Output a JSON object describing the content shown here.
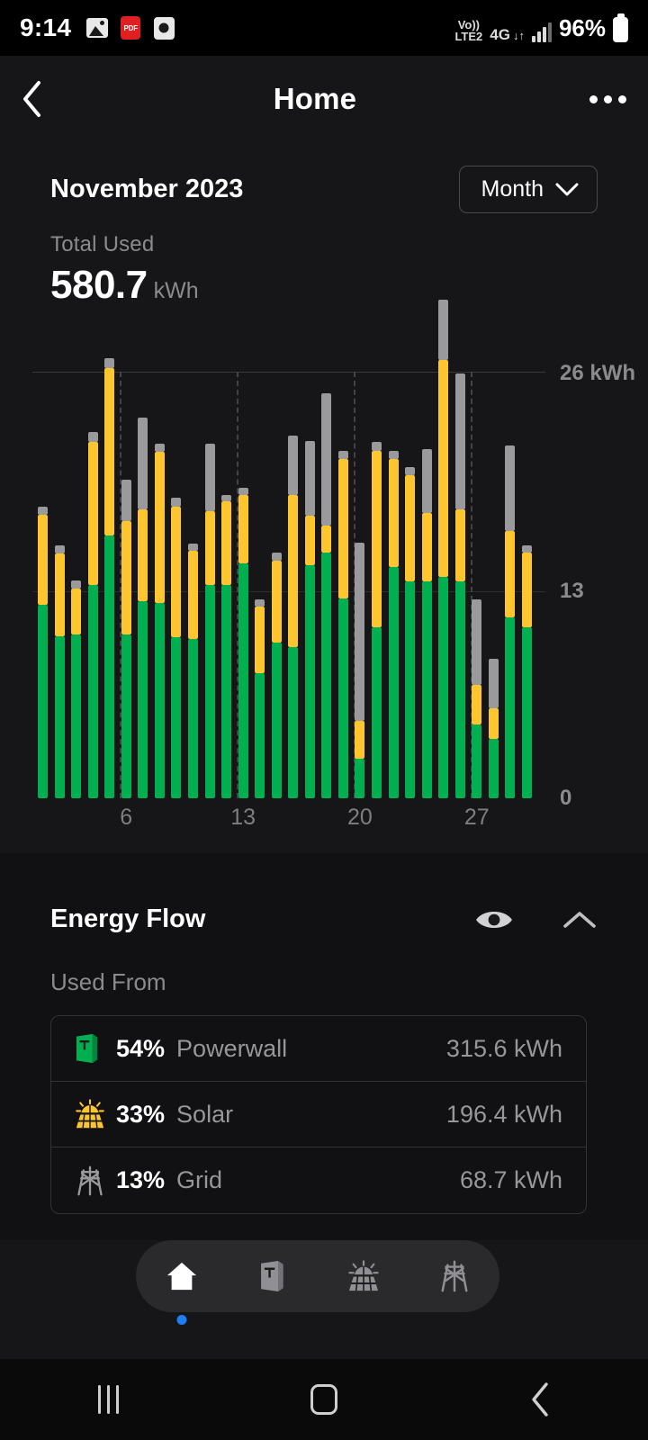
{
  "statusbar": {
    "time": "9:14",
    "icons": [
      "photo-icon",
      "pdf-icon",
      "clock-icon"
    ],
    "volte_top": "Vo))",
    "volte_bottom": "LTE2",
    "network": "4G",
    "data_arrows": "↓↑",
    "battery_pct": "96%"
  },
  "header": {
    "back_icon": "chevron-left-icon",
    "title": "Home",
    "overflow_icon": "more-options-icon"
  },
  "date_row": {
    "month_year": "November 2023",
    "period_label": "Month",
    "period_chevron": "chevron-down-icon"
  },
  "total": {
    "label": "Total Used",
    "value": "580.7",
    "unit": "kWh"
  },
  "chart_data": {
    "type": "bar",
    "title": "",
    "subtitle": "",
    "xlabel": "",
    "ylabel": "kWh",
    "ylim": [
      0,
      26
    ],
    "yticks": [
      0,
      13,
      26
    ],
    "ytick_labels": [
      "0",
      "13",
      "26 kWh"
    ],
    "grid": true,
    "legend_position": "none",
    "stacked": true,
    "categories": [
      1,
      2,
      3,
      4,
      5,
      6,
      7,
      8,
      9,
      10,
      11,
      12,
      13,
      14,
      15,
      16,
      17,
      18,
      19,
      20,
      21,
      22,
      23,
      24,
      25,
      26,
      27,
      28,
      29,
      30
    ],
    "xtick_labels": [
      "6",
      "13",
      "20",
      "27"
    ],
    "xtick_positions": [
      6,
      13,
      20,
      27
    ],
    "series": [
      {
        "name": "Powerwall",
        "color": "#00b050",
        "values": [
          11.8,
          9.9,
          10.0,
          13.0,
          16.0,
          10.0,
          12.0,
          11.9,
          9.8,
          9.7,
          13.0,
          13.0,
          14.3,
          7.6,
          9.5,
          9.2,
          14.2,
          15.0,
          12.2,
          2.4,
          10.4,
          14.1,
          13.2,
          13.2,
          13.5,
          13.2,
          4.5,
          3.6,
          11.0,
          10.4
        ]
      },
      {
        "name": "Solar",
        "color": "#fdc62e",
        "values": [
          5.5,
          5.0,
          2.8,
          8.7,
          10.2,
          6.9,
          5.6,
          9.2,
          8.0,
          5.4,
          4.5,
          5.1,
          4.2,
          4.1,
          5.0,
          9.3,
          3.0,
          1.6,
          8.5,
          2.3,
          10.8,
          6.6,
          6.5,
          4.2,
          13.2,
          4.4,
          2.4,
          1.9,
          5.3,
          4.6
        ]
      },
      {
        "name": "Grid",
        "color": "#9a9a9d",
        "values": [
          0.5,
          0.5,
          0.5,
          0.6,
          0.6,
          2.5,
          5.6,
          0.5,
          0.5,
          0.4,
          4.1,
          0.4,
          0.4,
          0.4,
          0.5,
          3.6,
          4.6,
          8.1,
          0.5,
          10.9,
          0.5,
          0.5,
          0.5,
          3.9,
          3.7,
          8.3,
          5.2,
          3.0,
          5.2,
          0.4
        ]
      }
    ]
  },
  "energy_flow": {
    "title": "Energy Flow",
    "eye_icon": "eye-icon",
    "collapse_icon": "chevron-up-icon",
    "used_from_label": "Used From",
    "rows": [
      {
        "icon": "powerwall-icon",
        "percent": "54%",
        "name": "Powerwall",
        "value": "315.6 kWh",
        "color": "#00b050"
      },
      {
        "icon": "solar-icon",
        "percent": "33%",
        "name": "Solar",
        "value": "196.4 kWh",
        "color": "#fdc62e"
      },
      {
        "icon": "grid-icon",
        "percent": "13%",
        "name": "Grid",
        "value": "68.7 kWh",
        "color": "#9a9a9d"
      }
    ]
  },
  "pill_nav": {
    "items": [
      {
        "icon": "home-icon",
        "label": "Home",
        "active": true
      },
      {
        "icon": "powerwall-icon",
        "label": "Powerwall",
        "active": false
      },
      {
        "icon": "solar-icon",
        "label": "Solar",
        "active": false
      },
      {
        "icon": "grid-icon",
        "label": "Grid",
        "active": false
      }
    ],
    "active_indicator_color": "#1d7ff0"
  },
  "android_nav": {
    "recents_icon": "recents-icon",
    "home_icon": "home-square-icon",
    "back_icon": "back-chevron-icon"
  },
  "colors": {
    "powerwall": "#00b050",
    "solar": "#fdc62e",
    "grid": "#9a9a9d",
    "background": "#161618",
    "panel": "#111113",
    "accent": "#1d7ff0"
  }
}
